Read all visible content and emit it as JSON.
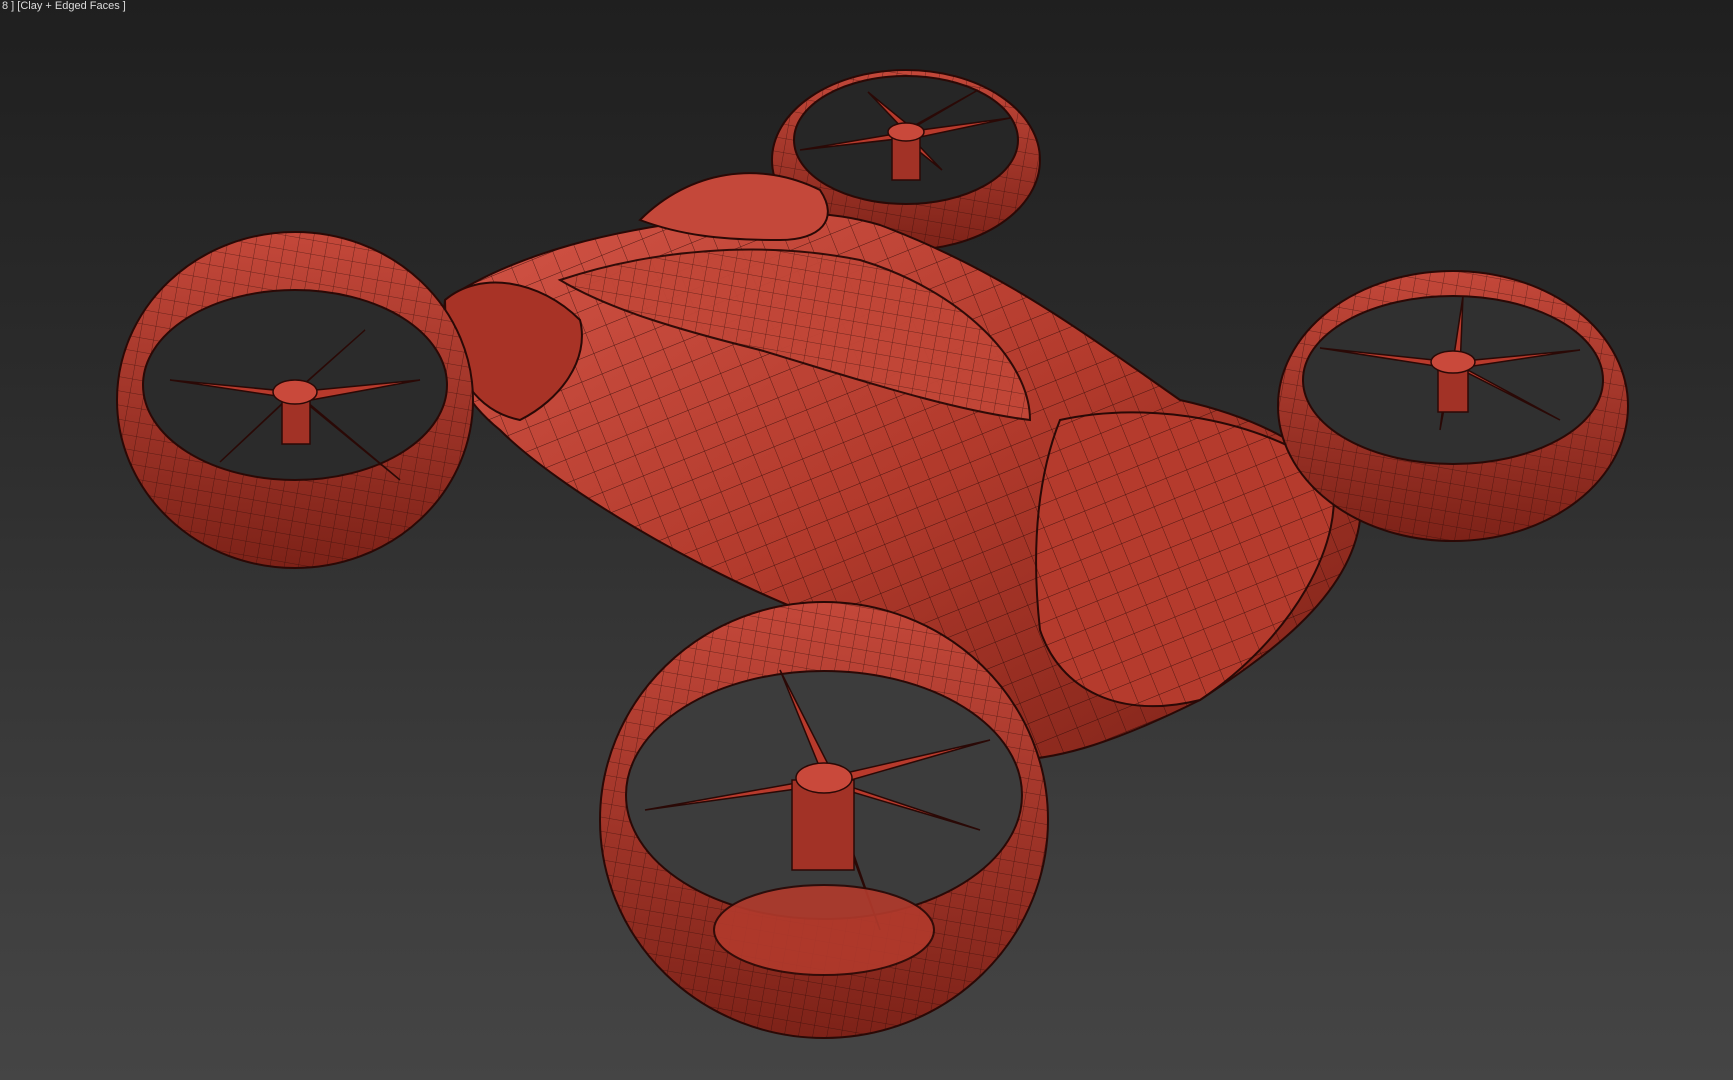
{
  "viewport": {
    "label": "8 ] [Clay + Edged Faces ]",
    "shading_mode": "Clay + Edged Faces",
    "background_top": "#1f1f1f",
    "background_bottom": "#454545"
  },
  "model": {
    "name": "drone-vehicle",
    "rotor_count": 4,
    "blades_per_rotor": 5,
    "clay_color": "#b8392b",
    "clay_dark": "#6e1a12",
    "clay_light": "#d9574a",
    "wire_color": "#2a0906"
  }
}
